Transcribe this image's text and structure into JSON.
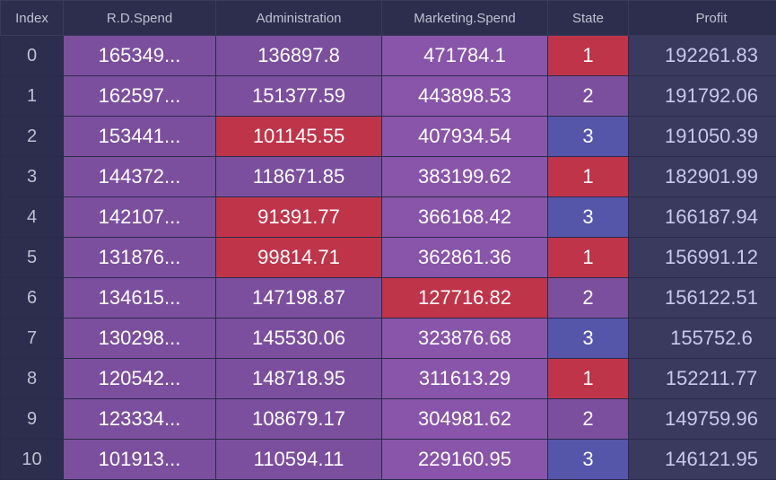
{
  "headers": {
    "index": "Index",
    "rdspend": "R.D.Spend",
    "administration": "Administration",
    "marketing": "Marketing.Spend",
    "state": "State",
    "profit": "Profit"
  },
  "rows": [
    {
      "index": "0",
      "rdspend": "165349...",
      "administration": "136897.8",
      "marketing": "471784.1",
      "state": "1",
      "profit": "192261.83",
      "admin_style": "admin-purple",
      "state_style": "state-red",
      "marketing_style": "marketing-purple"
    },
    {
      "index": "1",
      "rdspend": "162597...",
      "administration": "151377.59",
      "marketing": "443898.53",
      "state": "2",
      "profit": "191792.06",
      "admin_style": "admin-purple",
      "state_style": "state-purple",
      "marketing_style": "marketing-purple"
    },
    {
      "index": "2",
      "rdspend": "153441...",
      "administration": "101145.55",
      "marketing": "407934.54",
      "state": "3",
      "profit": "191050.39",
      "admin_style": "admin-red",
      "state_style": "state-blue",
      "marketing_style": "marketing-purple"
    },
    {
      "index": "3",
      "rdspend": "144372...",
      "administration": "118671.85",
      "marketing": "383199.62",
      "state": "1",
      "profit": "182901.99",
      "admin_style": "admin-purple",
      "state_style": "state-red",
      "marketing_style": "marketing-purple"
    },
    {
      "index": "4",
      "rdspend": "142107...",
      "administration": "91391.77",
      "marketing": "366168.42",
      "state": "3",
      "profit": "166187.94",
      "admin_style": "admin-red",
      "state_style": "state-blue",
      "marketing_style": "marketing-purple"
    },
    {
      "index": "5",
      "rdspend": "131876...",
      "administration": "99814.71",
      "marketing": "362861.36",
      "state": "1",
      "profit": "156991.12",
      "admin_style": "admin-red",
      "state_style": "state-red",
      "marketing_style": "marketing-purple"
    },
    {
      "index": "6",
      "rdspend": "134615...",
      "administration": "147198.87",
      "marketing": "127716.82",
      "state": "2",
      "profit": "156122.51",
      "admin_style": "admin-purple",
      "state_style": "state-purple",
      "marketing_style": "marketing-red"
    },
    {
      "index": "7",
      "rdspend": "130298...",
      "administration": "145530.06",
      "marketing": "323876.68",
      "state": "3",
      "profit": "155752.6",
      "admin_style": "admin-purple",
      "state_style": "state-blue",
      "marketing_style": "marketing-purple"
    },
    {
      "index": "8",
      "rdspend": "120542...",
      "administration": "148718.95",
      "marketing": "311613.29",
      "state": "1",
      "profit": "152211.77",
      "admin_style": "admin-purple",
      "state_style": "state-red",
      "marketing_style": "marketing-purple"
    },
    {
      "index": "9",
      "rdspend": "123334...",
      "administration": "108679.17",
      "marketing": "304981.62",
      "state": "2",
      "profit": "149759.96",
      "admin_style": "admin-purple",
      "state_style": "state-purple",
      "marketing_style": "marketing-purple"
    },
    {
      "index": "10",
      "rdspend": "101913...",
      "administration": "110594.11",
      "marketing": "229160.95",
      "state": "3",
      "profit": "146121.95",
      "admin_style": "admin-purple",
      "state_style": "state-blue",
      "marketing_style": "marketing-purple"
    }
  ]
}
